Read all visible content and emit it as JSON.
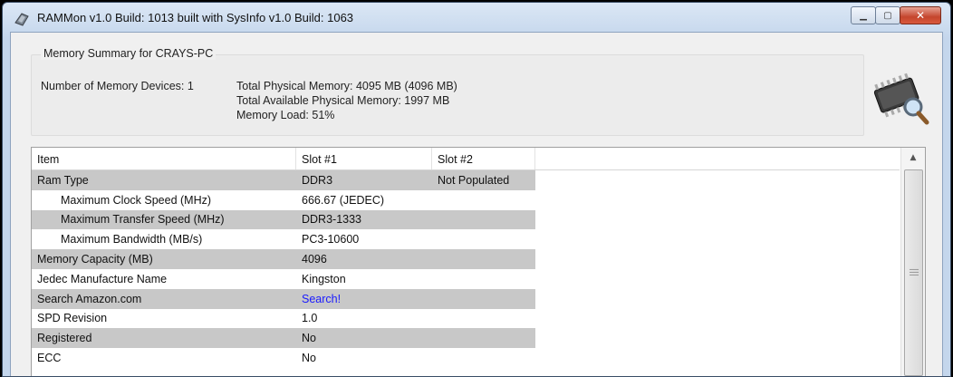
{
  "window": {
    "title": "RAMMon v1.0 Build: 1013 built with SysInfo v1.0 Build: 1063"
  },
  "summary": {
    "legend": "Memory Summary for CRAYS-PC",
    "devices": "Number of Memory Devices: 1",
    "total_physical": "Total Physical Memory: 4095 MB (4096 MB)",
    "total_available": "Total Available Physical Memory: 1997 MB",
    "memory_load": "Memory Load: 51%"
  },
  "table": {
    "columns": [
      "Item",
      "Slot #1",
      "Slot #2"
    ],
    "rows": [
      {
        "item": "Ram Type",
        "slot1": "DDR3",
        "slot2": "Not Populated"
      },
      {
        "item": "Maximum Clock Speed (MHz)",
        "slot1": "666.67 (JEDEC)",
        "slot2": ""
      },
      {
        "item": "Maximum Transfer Speed (MHz)",
        "slot1": "DDR3-1333",
        "slot2": ""
      },
      {
        "item": "Maximum Bandwidth (MB/s)",
        "slot1": "PC3-10600",
        "slot2": ""
      },
      {
        "item": "Memory Capacity (MB)",
        "slot1": "4096",
        "slot2": ""
      },
      {
        "item": "Jedec Manufacture Name",
        "slot1": "Kingston",
        "slot2": ""
      },
      {
        "item": "Search Amazon.com",
        "slot1": "Search!",
        "slot2": ""
      },
      {
        "item": "SPD Revision",
        "slot1": "1.0",
        "slot2": ""
      },
      {
        "item": "Registered",
        "slot1": "No",
        "slot2": ""
      },
      {
        "item": "ECC",
        "slot1": "No",
        "slot2": ""
      }
    ]
  },
  "icons": {
    "app": "rammon-app-icon",
    "summary": "memory-chip-magnifier-icon"
  },
  "colors": {
    "link": "#1a1aff",
    "row_shade": "#c8c8c8",
    "close_button": "#c4452d"
  }
}
